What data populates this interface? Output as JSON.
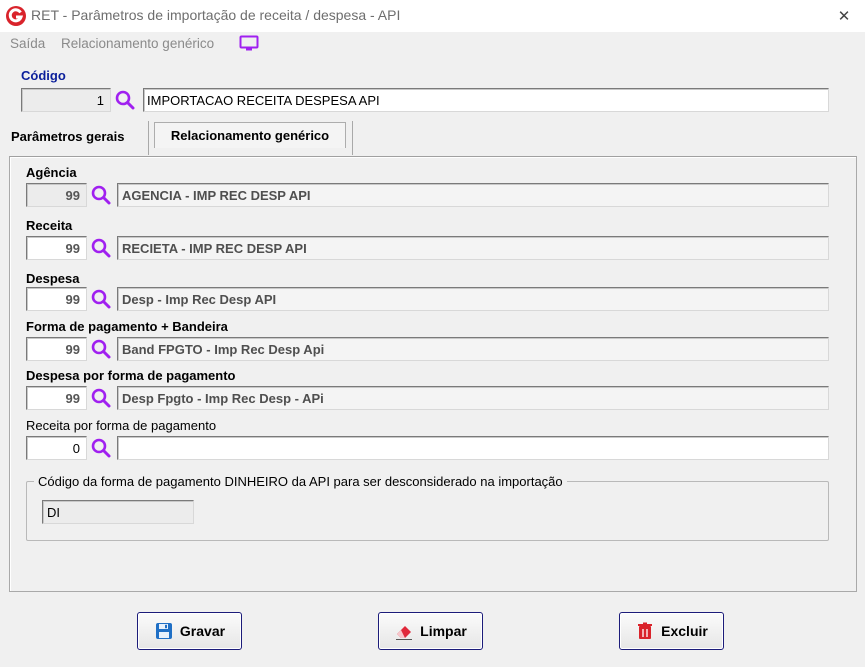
{
  "window": {
    "title": "RET - Parâmetros de importação de receita / despesa - API",
    "close_label": "✕"
  },
  "menu": {
    "items": [
      "Saída",
      "Relacionamento genérico"
    ]
  },
  "codigo": {
    "label": "Código",
    "value": "1",
    "description": "IMPORTACAO RECEITA DESPESA API"
  },
  "tabs": [
    "Parâmetros gerais",
    "Relacionamento genérico"
  ],
  "fields": [
    {
      "label": "Agência",
      "value": "99",
      "description": "AGENCIA - IMP REC DESP API"
    },
    {
      "label": "Receita",
      "value": "99",
      "description": "RECIETA - IMP REC DESP API"
    },
    {
      "label": "Despesa",
      "value": "99",
      "description": "Desp - Imp Rec Desp API"
    },
    {
      "label": "Forma de pagamento + Bandeira",
      "value": "99",
      "description": "Band FPGTO - Imp Rec Desp Api"
    },
    {
      "label": "Despesa por forma de pagamento",
      "value": "99",
      "description": "Desp Fpgto - Imp Rec Desp - APi"
    },
    {
      "label": "Receita por forma de pagamento",
      "value": "0",
      "description": ""
    }
  ],
  "group": {
    "title": "Código da forma de pagamento DINHEIRO da API  para ser desconsiderado na importação",
    "value": "DI"
  },
  "buttons": {
    "save": "Gravar",
    "clear": "Limpar",
    "delete": "Excluir"
  },
  "colors": {
    "accent": "#a020f0",
    "logo_red": "#d9232b",
    "delete_red": "#d9232b",
    "label_blue": "#0b1f9b"
  }
}
